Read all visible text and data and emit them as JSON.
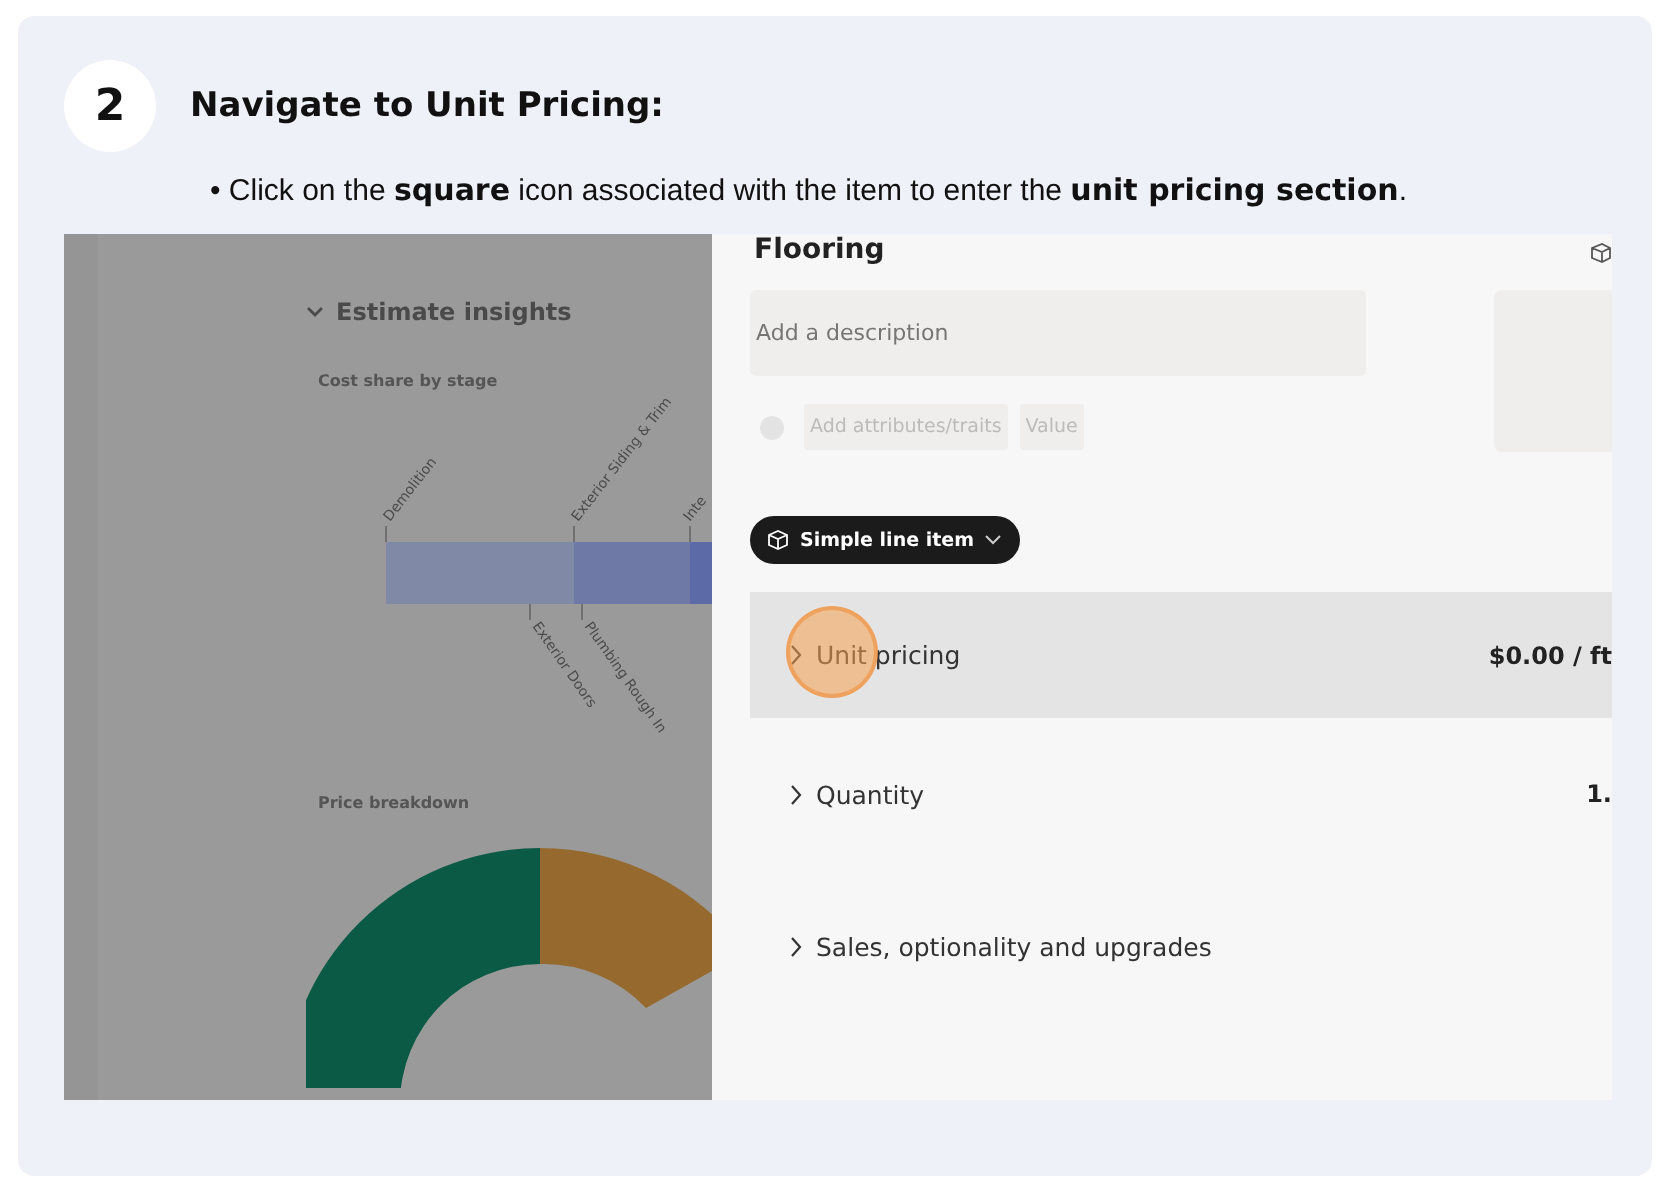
{
  "step": {
    "number": "2",
    "title": "Navigate to Unit Pricing:"
  },
  "instruction": "• Click on the **square** icon associated with the item to enter the **unit pricing section**.",
  "screenshot": {
    "insights": {
      "title": "Estimate insights",
      "expanded": true,
      "cost_chart_title": "Cost share by stage",
      "stage_labels_top": [
        "Demolition",
        "Exterior Siding & Trim",
        "Inte"
      ],
      "stage_labels_bottom": [
        "Exterior Doors",
        "Plumbing Rough In"
      ],
      "price_chart_title": "Price breakdown"
    },
    "item": {
      "title": "Flooring",
      "description_placeholder": "Add a description",
      "attribute_placeholder": "Add attributes/traits",
      "value_placeholder": "Value",
      "type_button": "Simple line item",
      "sections": [
        {
          "label": "Unit pricing",
          "value": "$0.00 / ft",
          "selected": true
        },
        {
          "label": "Quantity",
          "value": "1.",
          "selected": false
        },
        {
          "label": "Sales, optionality and upgrades",
          "selected": false
        }
      ]
    }
  }
}
